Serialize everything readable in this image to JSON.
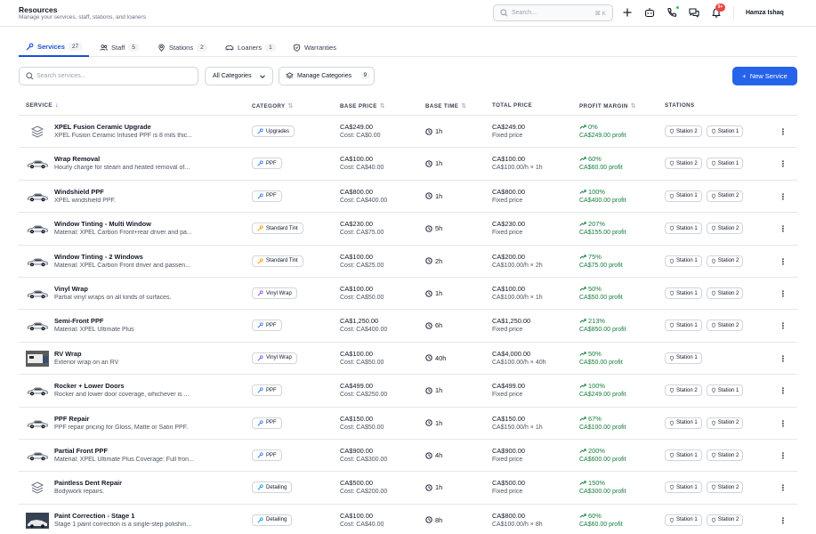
{
  "header": {
    "title": "Resources",
    "subtitle": "Manage your services, staff, stations, and loaners",
    "search_placeholder": "Search...",
    "search_shortcut": "⌘ K",
    "notification_count": "9+",
    "user_name": "Hamza Ishaq"
  },
  "tabs": [
    {
      "label": "Services",
      "count": "27",
      "icon": "wrench-icon"
    },
    {
      "label": "Staff",
      "count": "5",
      "icon": "users-icon"
    },
    {
      "label": "Stations",
      "count": "2",
      "icon": "map-pin-icon"
    },
    {
      "label": "Loaners",
      "count": "1",
      "icon": "car-icon"
    },
    {
      "label": "Warranties",
      "count": "",
      "icon": "shield-icon"
    }
  ],
  "toolbar": {
    "search_placeholder": "Search services...",
    "category_filter": "All Categories",
    "manage_categories_label": "Manage Categories",
    "manage_categories_count": "9",
    "new_service_label": "New Service"
  },
  "columns": [
    "SERVICE",
    "CATEGORY",
    "BASE PRICE",
    "BASE TIME",
    "TOTAL PRICE",
    "PROFIT MARGIN",
    "STATIONS"
  ],
  "colors": {
    "accent": "#2563eb",
    "profit": "#15803d"
  },
  "rows": [
    {
      "name": "XPEL Fusion Ceramic Upgrade",
      "desc": "XPEL Fusion Ceramic Infused PPF is 8 mils thic...",
      "thumb": "layers",
      "category": "Upgrades",
      "cat_icon": "wrench",
      "base_price": "CA$249.00",
      "cost": "Cost: CA$0.00",
      "time": "1h",
      "total": "CA$249.00",
      "total_sub": "Fixed price",
      "margin": "0%",
      "profit": "CA$249.00 profit",
      "stations": [
        "Station 2",
        "Station 1"
      ]
    },
    {
      "name": "Wrap Removal",
      "desc": "Hourly charge for steam and heated removal of...",
      "thumb": "car",
      "category": "PPF",
      "cat_icon": "wrench",
      "base_price": "CA$100.00",
      "cost": "Cost: CA$40.00",
      "time": "1h",
      "total": "CA$100.00",
      "total_sub": "CA$100.00/h × 1h",
      "margin": "60%",
      "profit": "CA$60.00 profit",
      "stations": [
        "Station 2",
        "Station 1"
      ]
    },
    {
      "name": "Windshield PPF",
      "desc": "XPEL windshield PPF.",
      "thumb": "car",
      "category": "PPF",
      "cat_icon": "wrench",
      "base_price": "CA$800.00",
      "cost": "Cost: CA$400.00",
      "time": "1h",
      "total": "CA$800.00",
      "total_sub": "Fixed price",
      "margin": "100%",
      "profit": "CA$400.00 profit",
      "stations": [
        "Station 1",
        "Station 2"
      ]
    },
    {
      "name": "Window Tinting - Multi Window",
      "desc": "Material: XPEL Carbon Front+rear driver and pa...",
      "thumb": "car",
      "category": "Standard Tint",
      "cat_icon": "wrench-orange",
      "base_price": "CA$230.00",
      "cost": "Cost: CA$75.00",
      "time": "5h",
      "total": "CA$230.00",
      "total_sub": "Fixed price",
      "margin": "207%",
      "profit": "CA$155.00 profit",
      "stations": [
        "Station 1",
        "Station 2"
      ]
    },
    {
      "name": "Window Tinting - 2 Windows",
      "desc": "Material: XPEL Carbon Front driver and passen...",
      "thumb": "car",
      "category": "Standard Tint",
      "cat_icon": "wrench-orange",
      "base_price": "CA$100.00",
      "cost": "Cost: CA$25.00",
      "time": "2h",
      "total": "CA$200.00",
      "total_sub": "CA$100.00/h × 2h",
      "margin": "75%",
      "profit": "CA$75.00 profit",
      "stations": [
        "Station 1",
        "Station 2"
      ]
    },
    {
      "name": "Vinyl Wrap",
      "desc": "Partial vinyl wraps on all kinds of surfaces.",
      "thumb": "car",
      "category": "Vinyl Wrap",
      "cat_icon": "wrench-purple",
      "base_price": "CA$100.00",
      "cost": "Cost: CA$50.00",
      "time": "1h",
      "total": "CA$100.00",
      "total_sub": "CA$100.00/h × 1h",
      "margin": "50%",
      "profit": "CA$50.00 profit",
      "stations": [
        "Station 1",
        "Station 2"
      ]
    },
    {
      "name": "Semi-Front PPF",
      "desc": "Material: XPEL Ultimate Plus",
      "thumb": "car",
      "category": "PPF",
      "cat_icon": "wrench",
      "base_price": "CA$1,250.00",
      "cost": "Cost: CA$400.00",
      "time": "6h",
      "total": "CA$1,250.00",
      "total_sub": "Fixed price",
      "margin": "213%",
      "profit": "CA$850.00 profit",
      "stations": [
        "Station 1",
        "Station 2"
      ]
    },
    {
      "name": "RV Wrap",
      "desc": "Exterior wrap on an RV",
      "thumb": "photo",
      "category": "Vinyl Wrap",
      "cat_icon": "wrench-purple",
      "base_price": "CA$100.00",
      "cost": "Cost: CA$50.00",
      "time": "40h",
      "total": "CA$4,000.00",
      "total_sub": "CA$100.00/h × 40h",
      "margin": "50%",
      "profit": "CA$50.00 profit",
      "stations": [
        "Station 1"
      ]
    },
    {
      "name": "Rocker + Lower Doors",
      "desc": "Rocker and lower door coverage, whichever is ...",
      "thumb": "car",
      "category": "PPF",
      "cat_icon": "wrench",
      "base_price": "CA$499.00",
      "cost": "Cost: CA$250.00",
      "time": "1h",
      "total": "CA$499.00",
      "total_sub": "Fixed price",
      "margin": "100%",
      "profit": "CA$249.00 profit",
      "stations": [
        "Station 2",
        "Station 1"
      ]
    },
    {
      "name": "PPF Repair",
      "desc": "PPF repair pricing for Gloss, Matte or Satin PPF.",
      "thumb": "car",
      "category": "PPF",
      "cat_icon": "wrench",
      "base_price": "CA$150.00",
      "cost": "Cost: CA$50.00",
      "time": "1h",
      "total": "CA$150.00",
      "total_sub": "CA$150.00/h × 1h",
      "margin": "67%",
      "profit": "CA$100.00 profit",
      "stations": [
        "Station 1",
        "Station 2"
      ]
    },
    {
      "name": "Partial Front PPF",
      "desc": "Material: XPEL Ultimate Plus Coverage: Full fron...",
      "thumb": "car",
      "category": "PPF",
      "cat_icon": "wrench",
      "base_price": "CA$900.00",
      "cost": "Cost: CA$300.00",
      "time": "4h",
      "total": "CA$900.00",
      "total_sub": "Fixed price",
      "margin": "200%",
      "profit": "CA$600.00 profit",
      "stations": [
        "Station 1",
        "Station 2"
      ]
    },
    {
      "name": "Paintless Dent Repair",
      "desc": "Bodywork repairs.",
      "thumb": "layers",
      "category": "Detailing",
      "cat_icon": "wrench-blue",
      "base_price": "CA$500.00",
      "cost": "Cost: CA$200.00",
      "time": "1h",
      "total": "CA$500.00",
      "total_sub": "Fixed price",
      "margin": "150%",
      "profit": "CA$300.00 profit",
      "stations": [
        "Station 1",
        "Station 2"
      ]
    },
    {
      "name": "Paint Correction - Stage 1",
      "desc": "Stage 1 paint correction is a single-step polishin...",
      "thumb": "photo2",
      "category": "Detailing",
      "cat_icon": "wrench-blue",
      "base_price": "CA$100.00",
      "cost": "Cost: CA$40.00",
      "time": "8h",
      "total": "CA$800.00",
      "total_sub": "CA$100.00/h × 8h",
      "margin": "60%",
      "profit": "CA$60.00 profit",
      "stations": [
        "Station 1",
        "Station 2"
      ]
    }
  ]
}
